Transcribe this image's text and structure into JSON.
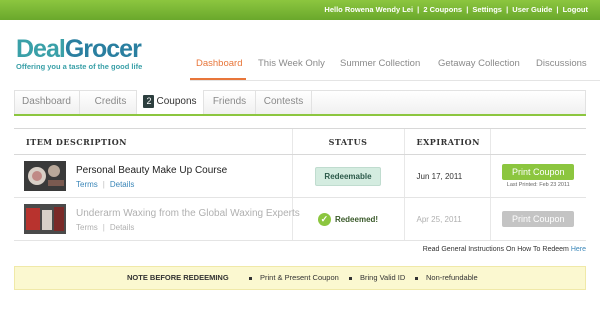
{
  "topbar": {
    "greeting": "Hello Rowena Wendy Lei",
    "coupons": "2 Coupons",
    "settings": "Settings",
    "user_guide": "User Guide",
    "logout": "Logout",
    "sep": "|"
  },
  "logo": {
    "deal": "Deal",
    "grocer": "Grocer",
    "tagline": "Offering you a taste of the good life"
  },
  "main_nav": [
    "Dashboard",
    "This Week Only",
    "Summer Collection",
    "Getaway Collection",
    "Discussions"
  ],
  "sub_tabs": {
    "dashboard": "Dashboard",
    "credits": "Credits",
    "coupons_count": "2",
    "coupons": "Coupons",
    "friends": "Friends",
    "contests": "Contests"
  },
  "table": {
    "headers": {
      "description": "ITEM DESCRIPTION",
      "status": "STATUS",
      "expiration": "EXPIRATION"
    },
    "rows": [
      {
        "title": "Personal Beauty Make Up Course",
        "terms": "Terms",
        "details": "Details",
        "status": "Redeemable",
        "expiration": "Jun 17, 2011",
        "button": "Print Coupon",
        "last_printed": "Last Printed: Feb 23 2011"
      },
      {
        "title": "Underarm Waxing from the Global Waxing Experts",
        "terms": "Terms",
        "details": "Details",
        "status": "Redeemed!",
        "expiration": "Apr 25, 2011",
        "button": "Print Coupon"
      }
    ]
  },
  "instructions": {
    "text": "Read General Instructions On How To Redeem",
    "link": "Here"
  },
  "note": {
    "label": "NOTE BEFORE REDEEMING",
    "points": [
      "Print & Present Coupon",
      "Bring Valid ID",
      "Non-refundable"
    ]
  },
  "colors": {
    "brand_green": "#8cc63f",
    "accent_orange": "#e8763a",
    "logo_teal": "#3aa0a8",
    "link_blue": "#3a86b8",
    "note_bg": "#fbf8d0"
  }
}
